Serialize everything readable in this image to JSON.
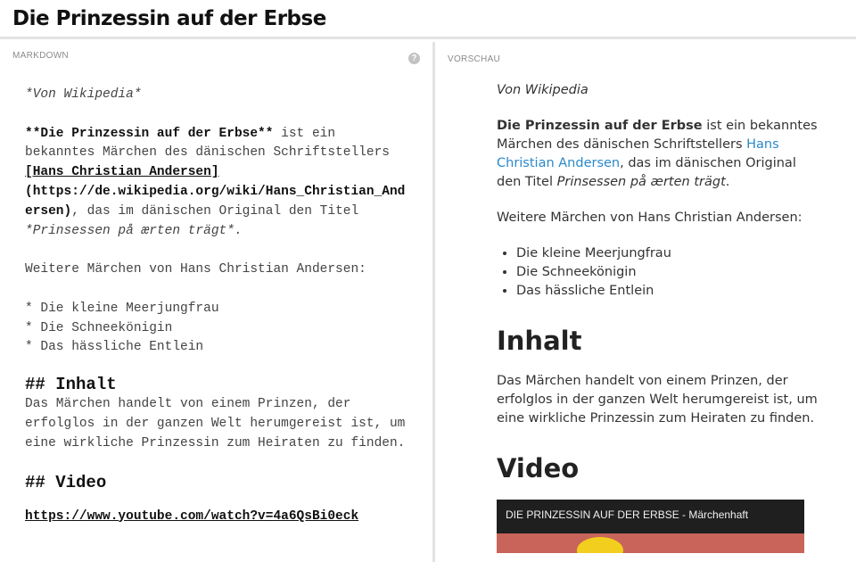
{
  "header": {
    "title": "Die Prinzessin auf der Erbse"
  },
  "editor": {
    "label": "MARKDOWN",
    "help_icon": "?",
    "lines": {
      "l1": "*Von Wikipedia*",
      "l2a": "**Die Prinzessin auf der Erbse**",
      "l2b": " ist ein",
      "l3": "bekanntes Märchen des dänischen Schriftstellers",
      "l4": "[Hans Christian Andersen]",
      "l5": "(https://de.wikipedia.org/wiki/Hans_Christian_And",
      "l6a": "ersen)",
      "l6b": ", das im dänischen Original den Titel",
      "l7": "*Prinsessen på ærten trägt*.",
      "l8": "Weitere Märchen von Hans Christian Andersen:",
      "l9": "* Die kleine Meerjungfrau",
      "l10": "* Die Schneekönigin",
      "l11": "* Das hässliche Entlein",
      "h_inhalt": "## Inhalt",
      "l12": "Das Märchen handelt von einem Prinzen, der",
      "l13": "erfolglos in der ganzen Welt herumgereist ist, um",
      "l14": "eine wirkliche Prinzessin zum Heiraten zu finden.",
      "h_video": "## Video",
      "url": "https://www.youtube.com/watch?v=4a6QsBi0eck"
    }
  },
  "preview": {
    "label": "VORSCHAU",
    "source": "Von Wikipedia",
    "intro_bold": "Die Prinzessin auf der Erbse",
    "intro_1": " ist ein bekanntes Märchen des dänischen Schriftstellers ",
    "link": "Hans Christian Andersen",
    "intro_2": ", das im dänischen Original den Titel ",
    "intro_em": "Prinsessen på ærten trägt",
    "intro_3": ".",
    "more": "Weitere Märchen von Hans Christian Andersen:",
    "list": [
      "Die kleine Meerjungfrau",
      "Die Schneekönigin",
      "Das hässliche Entlein"
    ],
    "h_inhalt": "Inhalt",
    "inhalt_text": "Das Märchen handelt von einem Prinzen, der erfolglos in der ganzen Welt herumgereist ist, um eine wirkliche Prinzessin zum Heiraten zu finden.",
    "h_video": "Video",
    "video_title": "DIE PRINZESSIN AUF DER ERBSE - Märchenhaft"
  },
  "colors": {
    "link": "#2a88c9",
    "divider": "#e3e3e3"
  }
}
